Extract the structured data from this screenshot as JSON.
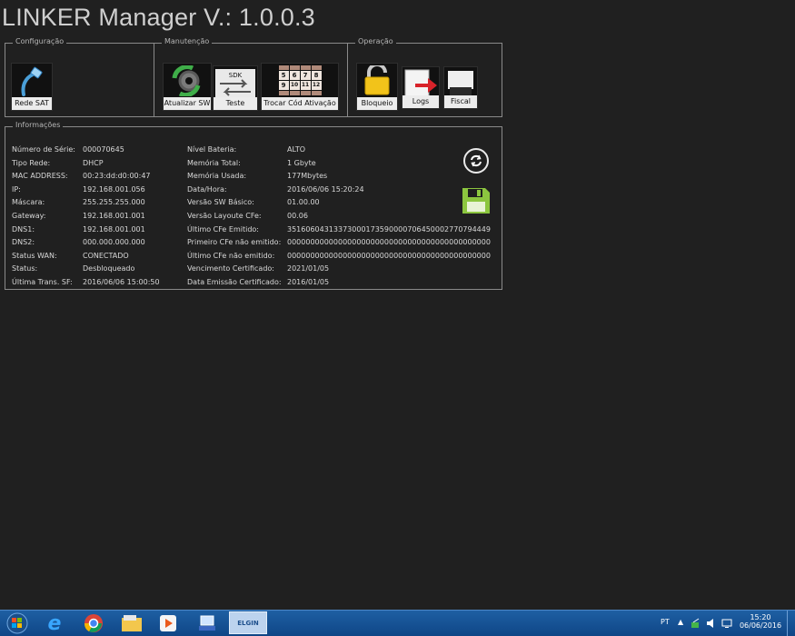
{
  "title": "LINKER Manager V.: 1.0.0.3",
  "groups": {
    "configuracao": {
      "title": "Configuração",
      "rede_sat": "Rede SAT"
    },
    "manutencao": {
      "title": "Manutenção",
      "atualizar_sw": "Atualizar SW",
      "teste": "Teste",
      "sdk_tag": "SDK",
      "trocar_cod": "Trocar Cód Ativação",
      "keypad_digits": [
        "5",
        "6",
        "7",
        "8",
        "9",
        "10",
        "11",
        "12"
      ]
    },
    "operacao": {
      "title": "Operação",
      "bloqueio": "Bloqueio",
      "logs": "Logs",
      "fiscal": "Fiscal"
    }
  },
  "info": {
    "title": "Informações",
    "left": [
      {
        "label": "Número de Série:",
        "value": "000070645"
      },
      {
        "label": "Tipo Rede:",
        "value": "DHCP"
      },
      {
        "label": "MAC ADDRESS:",
        "value": "00:23:dd:d0:00:47"
      },
      {
        "label": "IP:",
        "value": "192.168.001.056"
      },
      {
        "label": "Máscara:",
        "value": "255.255.255.000"
      },
      {
        "label": "Gateway:",
        "value": "192.168.001.001"
      },
      {
        "label": "DNS1:",
        "value": "192.168.001.001"
      },
      {
        "label": "DNS2:",
        "value": "000.000.000.000"
      },
      {
        "label": "Status WAN:",
        "value": "CONECTADO"
      },
      {
        "label": "Status:",
        "value": "Desbloqueado"
      },
      {
        "label": "Última Trans. SF:",
        "value": "2016/06/06 15:00:50"
      }
    ],
    "right": [
      {
        "label": "Nível Bateria:",
        "value": "ALTO"
      },
      {
        "label": "Memória Total:",
        "value": "1 Gbyte"
      },
      {
        "label": "Memória Usada:",
        "value": "177Mbytes"
      },
      {
        "label": "Data/Hora:",
        "value": "2016/06/06 15:20:24"
      },
      {
        "label": "Versão SW Básico:",
        "value": "01.00.00"
      },
      {
        "label": "Versão Layoute CFe:",
        "value": "00.06"
      },
      {
        "label": "Último CFe Emitido:",
        "value": "35160604313373000173590000706450002770794449"
      },
      {
        "label": "Primeiro CFe não emitido:",
        "value": "00000000000000000000000000000000000000000000"
      },
      {
        "label": "Último CFe não emitido:",
        "value": "00000000000000000000000000000000000000000000"
      },
      {
        "label": "Vencimento Certificado:",
        "value": "2021/01/05"
      },
      {
        "label": "Data Emissão Certificado:",
        "value": "2016/01/05"
      }
    ]
  },
  "taskbar": {
    "active_app": "ELGIN",
    "lang": "PT",
    "time": "15:20",
    "date": "06/06/2016",
    "ie_glyph": "e"
  },
  "colors": {
    "background": "#202020",
    "taskbar": "#1a5596",
    "save_icon": "#8cc63f",
    "tile_label_bg": "#ececec"
  }
}
